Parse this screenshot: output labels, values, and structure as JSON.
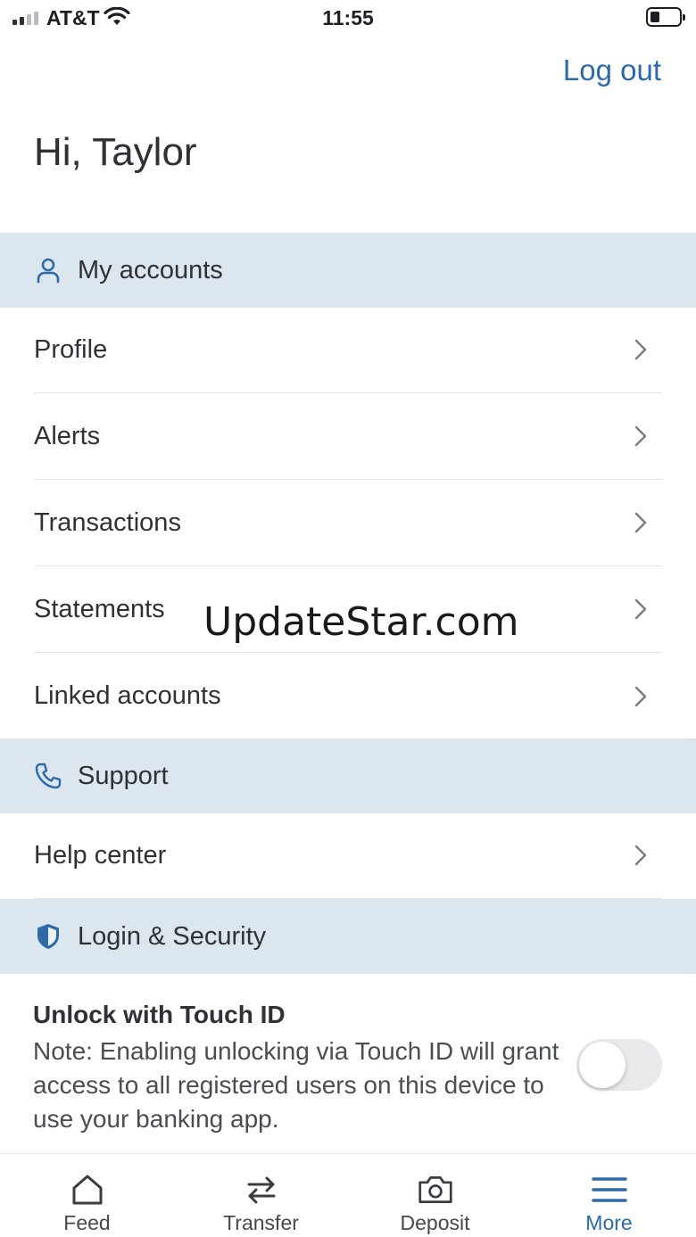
{
  "status_bar": {
    "carrier": "AT&T",
    "time": "11:55",
    "signal_bars_active": 2,
    "signal_bars_total": 4,
    "battery_level": 0.3
  },
  "header": {
    "logout_label": "Log out",
    "greeting": "Hi, Taylor"
  },
  "sections": {
    "my_accounts": {
      "label": "My accounts",
      "icon": "person-icon",
      "items": [
        {
          "label": "Profile"
        },
        {
          "label": "Alerts"
        },
        {
          "label": "Transactions"
        },
        {
          "label": "Statements"
        },
        {
          "label": "Linked accounts"
        }
      ]
    },
    "support": {
      "label": "Support",
      "icon": "phone-icon",
      "items": [
        {
          "label": "Help center"
        }
      ]
    },
    "login_security": {
      "label": "Login & Security",
      "icon": "shield-icon",
      "touch_id": {
        "title": "Unlock with Touch ID",
        "note": "Note: Enabling unlocking via Touch ID will grant access to all registered users on this device to use your banking app.",
        "enabled": false
      }
    }
  },
  "watermark": "UpdateStar.com",
  "tabbar": {
    "tabs": [
      {
        "label": "Feed",
        "icon": "home-icon",
        "active": false
      },
      {
        "label": "Transfer",
        "icon": "transfer-arrows-icon",
        "active": false
      },
      {
        "label": "Deposit",
        "icon": "camera-icon",
        "active": false
      },
      {
        "label": "More",
        "icon": "menu-icon",
        "active": true
      }
    ]
  },
  "colors": {
    "accent": "#2e6aa6",
    "section_bg": "#dce6ef",
    "text": "#2f3137"
  }
}
